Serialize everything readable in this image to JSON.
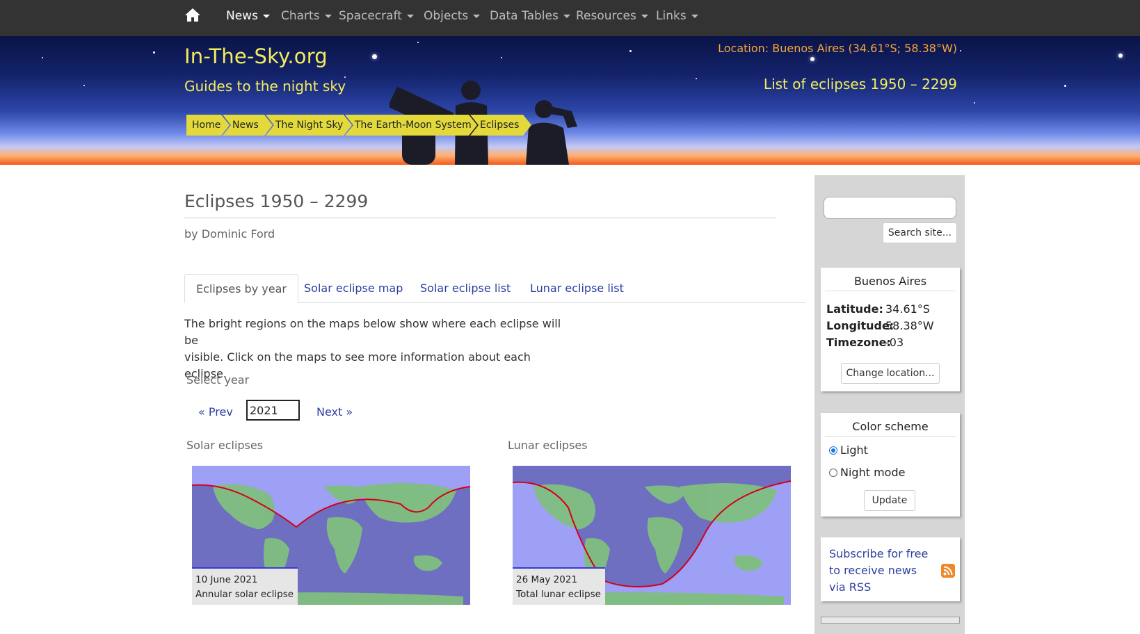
{
  "nav": {
    "home_icon": "home-icon",
    "items": [
      {
        "label": "News",
        "active": true
      },
      {
        "label": "Charts"
      },
      {
        "label": "Spacecraft"
      },
      {
        "label": "Objects"
      },
      {
        "label": "Data Tables"
      },
      {
        "label": "Resources"
      },
      {
        "label": "Links"
      }
    ]
  },
  "banner": {
    "site_title": "In-The-Sky.org",
    "site_subtitle": "Guides to the night sky",
    "location": "Location: Buenos Aires (34.61°S; 58.38°W)",
    "page_subtitle": "List of eclipses 1950 – 2299",
    "breadcrumbs": [
      "Home",
      "News",
      "The Night Sky",
      "The Earth-Moon System",
      "Eclipses"
    ]
  },
  "main": {
    "title": "Eclipses 1950 – 2299",
    "byline": "by Dominic Ford",
    "tabs": [
      "Eclipses by year",
      "Solar eclipse map",
      "Solar eclipse list",
      "Lunar eclipse list"
    ],
    "intro_line1": "The bright regions on the maps below show where each eclipse will be",
    "intro_line2": "visible. Click on the maps to see more information about each eclipse.",
    "select_label": "Select year",
    "prev_label": "« Prev",
    "year_value": "2021",
    "next_label": "Next »",
    "solar_label": "Solar eclipses",
    "lunar_label": "Lunar eclipses",
    "solar_card": {
      "date": "10 June 2021",
      "kind": "Annular solar eclipse"
    },
    "lunar_card": {
      "date": "26 May 2021",
      "kind": "Total lunar eclipse"
    }
  },
  "sidebar": {
    "search_button": "Search site...",
    "location_panel": {
      "title": "Buenos Aires",
      "latitude_label": "Latitude:",
      "latitude": "34.61°S",
      "longitude_label": "Longitude:",
      "longitude": "58.38°W",
      "timezone_label": "Timezone:",
      "timezone": "-03",
      "change_button": "Change location..."
    },
    "color_panel": {
      "title": "Color scheme",
      "option_light": "Light",
      "option_night": "Night mode",
      "selected": "Light",
      "update_button": "Update"
    },
    "rss_text": "Subscribe for free to receive news via RSS"
  },
  "colors": {
    "nav_bg": "#333333",
    "title_yellow": "#f4ee5a",
    "location_orange": "#f7a63a",
    "link_blue": "#2c3fa0",
    "map_land": "#7fbf7f",
    "map_sea_visible": "#9ea0f5",
    "map_dark": "#6f6fc2",
    "eclipse_line": "#d4001a"
  }
}
